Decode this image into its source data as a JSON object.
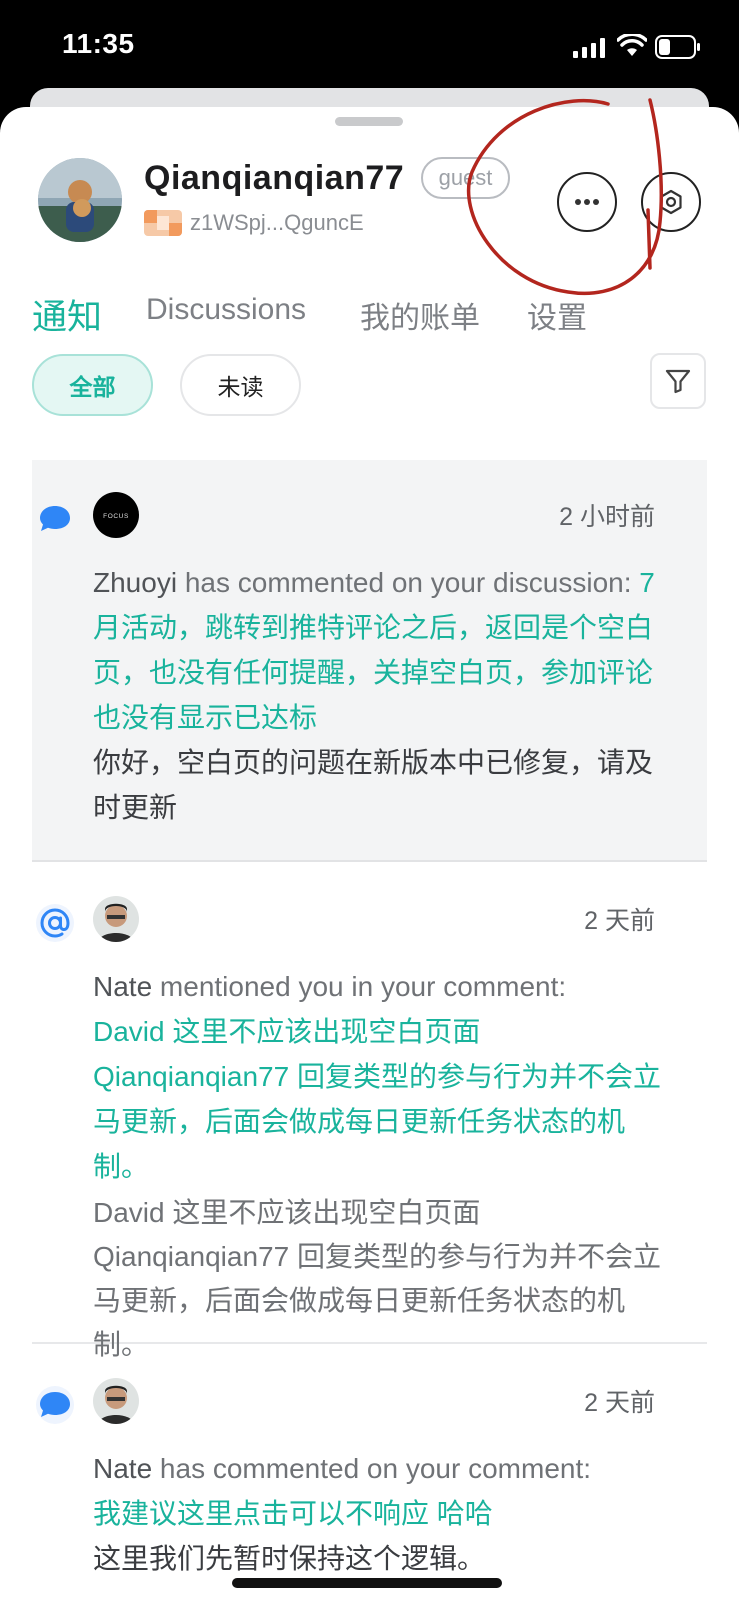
{
  "status_bar": {
    "time": "11:35",
    "signal_icon": "cellular-signal-icon",
    "wifi_icon": "wifi-icon",
    "battery_icon": "battery-icon"
  },
  "profile": {
    "username": "Qianqianqian77",
    "badge": "guest",
    "address": "z1WSpj...QguncE"
  },
  "tabs": [
    {
      "label": "通知",
      "active": true
    },
    {
      "label": "Discussions",
      "active": false
    },
    {
      "label": "我的账单",
      "active": false
    },
    {
      "label": "设置",
      "active": false
    }
  ],
  "filters": {
    "all": "全部",
    "unread": "未读",
    "filter_icon": "funnel-icon"
  },
  "colors": {
    "accent": "#19b39c",
    "comment_icon": "#2f86f6",
    "annotation_red": "#b3261e"
  },
  "notifications": [
    {
      "type_icon": "comment-bubble-icon",
      "time": "2 小时前",
      "actor": "Zhuoyi",
      "action": " has commented on your discussion: ",
      "target": "7月活动，跳转到推特评论之后，返回是个空白页，也没有任何提醒，关掉空白页，参加评论也没有显示已达标",
      "quote": "你好，空白页的问题在新版本中已修复，请及时更新"
    },
    {
      "type_icon": "at-mention-icon",
      "time": "2 天前",
      "actor": "Nate",
      "action": " mentioned you in your comment:",
      "target": "David 这里不应该出现空白页面 Qianqianqian77 回复类型的参与行为并不会立马更新，后面会做成每日更新任务状态的机制。",
      "quote": "David 这里不应该出现空白页面 Qianqianqian77 回复类型的参与行为并不会立马更新，后面会做成每日更新任务状态的机制。"
    },
    {
      "type_icon": "comment-bubble-icon",
      "time": "2 天前",
      "actor": "Nate",
      "action": " has commented on your comment:",
      "target": "我建议这里点击可以不响应 哈哈",
      "quote": "这里我们先暂时保持这个逻辑。"
    }
  ]
}
